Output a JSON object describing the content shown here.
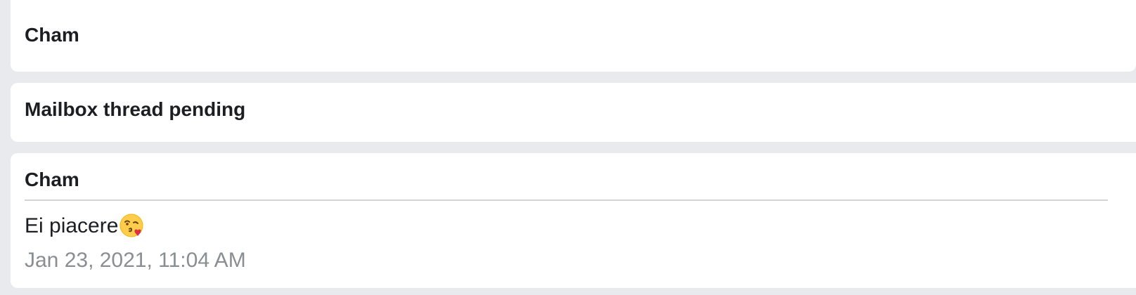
{
  "threads": [
    {
      "sender": "Cham"
    },
    {
      "status": "Mailbox thread pending"
    },
    {
      "sender": "Cham",
      "message": "Ei piacere",
      "emoji_icon": "face-blowing-kiss-icon",
      "timestamp": "Jan 23, 2021, 11:04 AM"
    }
  ],
  "colors": {
    "background": "#e9eaed",
    "card": "#ffffff",
    "text": "#1c1e21",
    "muted": "#8a8d91",
    "divider": "#d3d4d8"
  }
}
